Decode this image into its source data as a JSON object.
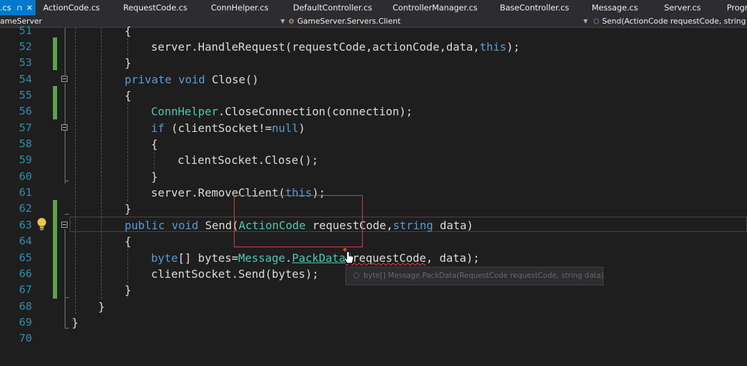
{
  "tabs": {
    "active": {
      "label": ".cs",
      "pin_icon": "pin-icon",
      "close_icon": "close-icon"
    },
    "items": [
      "ActionCode.cs",
      "RequestCode.cs",
      "ConnHelper.cs",
      "DefaultController.cs",
      "ControllerManager.cs",
      "BaseController.cs",
      "Message.cs",
      "Server.cs",
      "Progr"
    ]
  },
  "navbar": {
    "project": "ameServer",
    "class_path": "GameServer.Servers.Client",
    "member": "Send(ActionCode requestCode, string dat"
  },
  "editor": {
    "line_numbers": [
      "51",
      "52",
      "53",
      "54",
      "55",
      "56",
      "57",
      "58",
      "59",
      "60",
      "61",
      "62",
      "63",
      "64",
      "65",
      "66",
      "67",
      "68",
      "69",
      "70"
    ],
    "lines": {
      "l51": "{",
      "l52a": "server.HandleRequest(requestCode,actionCode,data,",
      "l52b": "this",
      "l52c": ");",
      "l53": "}",
      "l54a": "private",
      "l54b": " ",
      "l54c": "void",
      "l54d": " Close()",
      "l55": "{",
      "l56a": "ConnHelper",
      "l56b": ".CloseConnection(connection);",
      "l57a": "if",
      "l57b": " (clientSocket!=",
      "l57c": "null",
      "l57d": ")",
      "l58": "{",
      "l59": "clientSocket.Close();",
      "l60": "}",
      "l61a": "server.RemoveClient(",
      "l61b": "this",
      "l61c": ");",
      "l62": "}",
      "l63a": "public",
      "l63b": "void",
      "l63c": " Send(",
      "l63d": "ActionCode",
      "l63e": " requestCode,",
      "l63f": "string",
      "l63g": " data)",
      "l64": "{",
      "l65a": "byte",
      "l65b": "[] bytes=",
      "l65c": "Message",
      "l65d": ".",
      "l65e": "PackData",
      "l65f": "(requestCode",
      "l65g": ", data);",
      "l66": "clientSocket.Send(bytes);",
      "l67": "}",
      "l68": "}",
      "l69": "}"
    }
  },
  "tooltip": {
    "icon": "method-icon",
    "text": "byte[] Message.PackData(RequestCode requestCode, string data)"
  },
  "colors": {
    "background": "#1e1e1e",
    "keyword": "#569cd6",
    "type": "#4ec9b0",
    "text": "#dcdcdc",
    "line_number": "#2b91af",
    "accent": "#007acc",
    "change_marker": "#57a64a"
  }
}
